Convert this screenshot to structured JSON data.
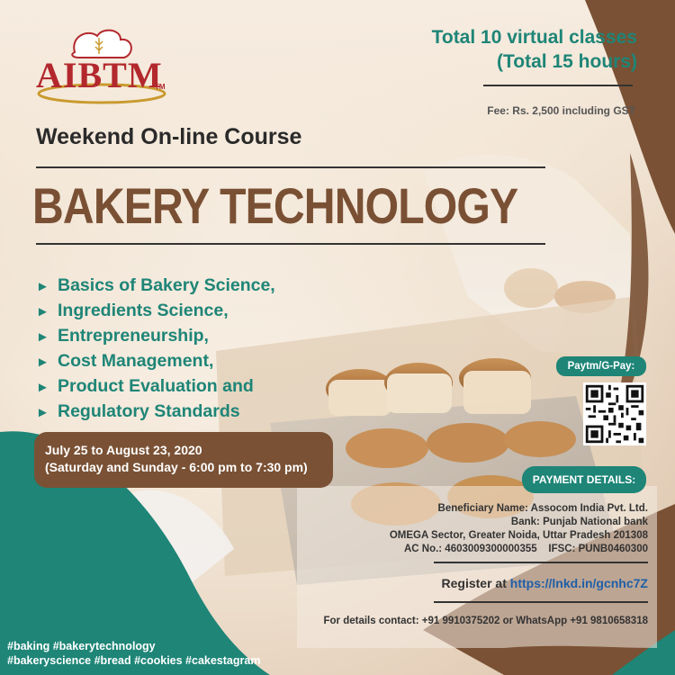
{
  "logo": {
    "text": "AIBTM",
    "tm": "TM"
  },
  "course": {
    "classes_line1": "Total 10 virtual classes",
    "classes_line2": "(Total 15 hours)",
    "fee": "Fee: Rs. 2,500 including GST",
    "subtitle": "Weekend On-line Course",
    "title": "BAKERY TECHNOLOGY",
    "topics": [
      "Basics of Bakery Science,",
      "Ingredients Science,",
      "Entrepreneurship,",
      "Cost Management,",
      "Product Evaluation and",
      "Regulatory Standards"
    ],
    "dates_line1": "July 25 to August 23, 2020",
    "dates_line2": "(Saturday and Sunday - 6:00 pm to 7:30 pm)"
  },
  "payment": {
    "paytm_label": "Paytm/G-Pay:",
    "details_label": "PAYMENT DETAILS:",
    "beneficiary": "Beneficiary Name: Assocom India Pvt. Ltd.",
    "bank": "Bank: Punjab National bank",
    "address": "OMEGA Sector, Greater Noida, Uttar Pradesh 201308",
    "account": "AC No.: 4603009300000355",
    "ifsc": "IFSC: PUNB0460300"
  },
  "register": {
    "label": "Register at",
    "link": "https://lnkd.in/gcnhc7Z"
  },
  "contact": "For details contact: +91 9910375202 or WhatsApp +91 9810658318",
  "tags": {
    "line1": "#baking #bakerytechnology",
    "line2": "#bakeryscience #bread #cookies #cakestagram"
  },
  "colors": {
    "teal": "#1e8577",
    "brown": "#7a5134",
    "logo_red": "#b3282d",
    "link_blue": "#1f5fa7"
  }
}
